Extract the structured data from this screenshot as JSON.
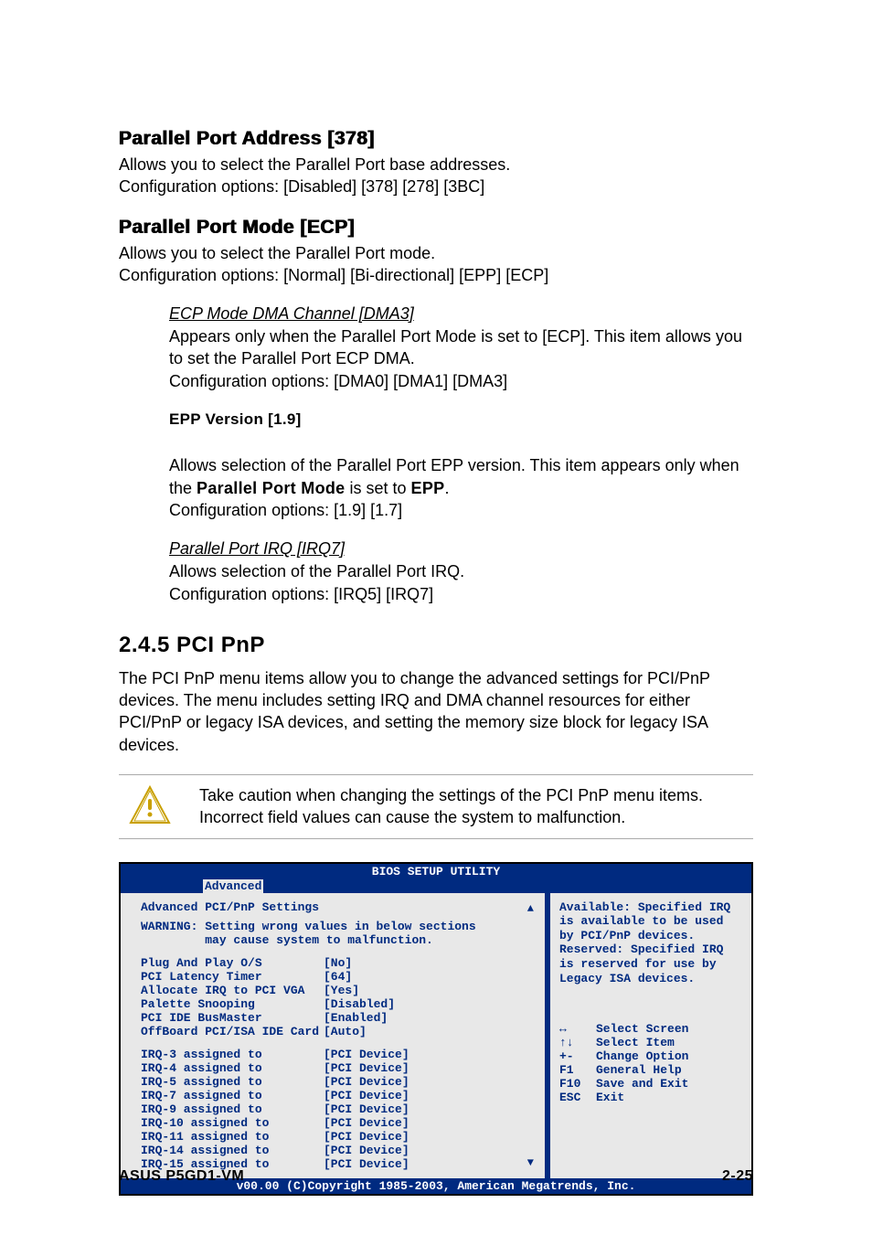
{
  "sections": {
    "s1": {
      "heading": "Parallel Port Address [378]",
      "body": "Allows you to select the Parallel Port base addresses.\nConfiguration options: [Disabled] [378] [278] [3BC]"
    },
    "s2": {
      "heading": "Parallel Port Mode [ECP]",
      "body": "Allows you to select the Parallel Port  mode.\nConfiguration options: [Normal] [Bi-directional] [EPP] [ECP]"
    },
    "s3": {
      "heading": "ECP Mode DMA Channel [DMA3]",
      "body": "Appears only when the Parallel Port Mode is set to [ECP]. This item allows you to set the Parallel Port ECP DMA.\nConfiguration options: [DMA0] [DMA1] [DMA3]"
    },
    "s4": {
      "heading": "EPP Version [1.9]",
      "body_pre": "Allows selection of the Parallel Port EPP version. This item appears only when the ",
      "body_bold1": "Parallel Port Mode",
      "body_mid": " is set to ",
      "body_bold2": "EPP",
      "body_post": ".\nConfiguration options: [1.9] [1.7]"
    },
    "s5": {
      "heading": "Parallel Port IRQ [IRQ7]",
      "body": "Allows selection of the Parallel Port IRQ.\nConfiguration options: [IRQ5] [IRQ7]"
    },
    "s6": {
      "heading": "2.4.5   PCI PnP",
      "body": "The PCI PnP menu items allow you to change the advanced settings for PCI/PnP devices. The menu includes setting IRQ and DMA channel resources for either PCI/PnP or legacy ISA devices, and setting the memory size block for legacy ISA devices."
    },
    "caution": "Take caution when changing the settings of the PCI PnP menu items. Incorrect field values can cause the system to malfunction."
  },
  "bios": {
    "title": "BIOS SETUP UTILITY",
    "tab": "Advanced",
    "section_title": "Advanced PCI/PnP Settings",
    "warning": "WARNING: Setting wrong values in below sections\n         may cause system to malfunction.",
    "items1": [
      {
        "label": "Plug And Play O/S",
        "value": "[No]"
      },
      {
        "label": "PCI Latency Timer",
        "value": "[64]"
      },
      {
        "label": "Allocate IRQ to PCI VGA",
        "value": "[Yes]"
      },
      {
        "label": "Palette Snooping",
        "value": "[Disabled]"
      },
      {
        "label": "PCI IDE BusMaster",
        "value": "[Enabled]"
      },
      {
        "label": "OffBoard PCI/ISA IDE Card",
        "value": "[Auto]"
      }
    ],
    "items2": [
      {
        "label": "IRQ-3 assigned to",
        "value": "[PCI Device]"
      },
      {
        "label": "IRQ-4 assigned to",
        "value": "[PCI Device]"
      },
      {
        "label": "IRQ-5 assigned to",
        "value": "[PCI Device]"
      },
      {
        "label": "IRQ-7 assigned to",
        "value": "[PCI Device]"
      },
      {
        "label": "IRQ-9 assigned to",
        "value": "[PCI Device]"
      },
      {
        "label": "IRQ-10 assigned to",
        "value": "[PCI Device]"
      },
      {
        "label": "IRQ-11 assigned to",
        "value": "[PCI Device]"
      },
      {
        "label": "IRQ-14 assigned to",
        "value": "[PCI Device]"
      },
      {
        "label": "IRQ-15 assigned to",
        "value": "[PCI Device]"
      }
    ],
    "help_text": "Available: Specified IRQ is available to be used by PCI/PnP devices.\nReserved: Specified IRQ is reserved for use by Legacy ISA devices.",
    "nav": [
      {
        "key": "↔",
        "action": "Select Screen"
      },
      {
        "key": "↑↓",
        "action": "Select Item"
      },
      {
        "key": "+-",
        "action": "Change Option"
      },
      {
        "key": "F1",
        "action": "General Help"
      },
      {
        "key": "F10",
        "action": "Save and Exit"
      },
      {
        "key": "ESC",
        "action": "Exit"
      }
    ],
    "footer": "v00.00 (C)Copyright 1985-2003, American Megatrends, Inc."
  },
  "page_footer": {
    "left": "ASUS P5GD1-VM",
    "right": "2-25"
  }
}
